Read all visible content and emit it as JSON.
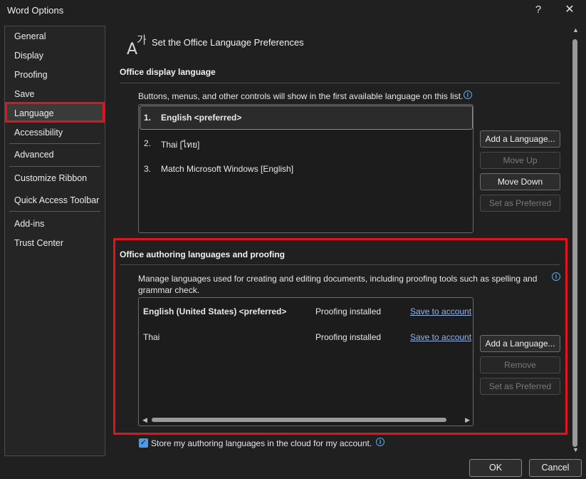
{
  "window": {
    "title": "Word Options",
    "help_label": "?",
    "close_label": "✕"
  },
  "sidebar": {
    "items": [
      {
        "label": "General"
      },
      {
        "label": "Display"
      },
      {
        "label": "Proofing"
      },
      {
        "label": "Save"
      },
      {
        "label": "Language"
      },
      {
        "label": "Accessibility"
      },
      {
        "label": "Advanced"
      },
      {
        "label": "Customize Ribbon"
      },
      {
        "label": "Quick Access Toolbar"
      },
      {
        "label": "Add-ins"
      },
      {
        "label": "Trust Center"
      }
    ],
    "active": "Language"
  },
  "header": {
    "icon": "language-icon",
    "title": "Set the Office Language Preferences"
  },
  "display_language": {
    "title": "Office display language",
    "description": "Buttons, menus, and other controls will show in the first available language on this list.",
    "items": [
      {
        "num": "1.",
        "label": "English <preferred>"
      },
      {
        "num": "2.",
        "label": "Thai [ไทย]"
      },
      {
        "num": "3.",
        "label": "Match Microsoft Windows [English]"
      }
    ],
    "buttons": {
      "add": "Add a Language...",
      "move_up": "Move Up",
      "move_down": "Move Down",
      "set_preferred": "Set as Preferred"
    }
  },
  "authoring": {
    "title": "Office authoring languages and proofing",
    "description": "Manage languages used for creating and editing documents, including proofing tools such as spelling and grammar check.",
    "rows": [
      {
        "language": "English (United States) <preferred>",
        "status": "Proofing installed",
        "action": "Save to account"
      },
      {
        "language": "Thai",
        "status": "Proofing installed",
        "action": "Save to account"
      }
    ],
    "buttons": {
      "add": "Add a Language...",
      "remove": "Remove",
      "set_preferred": "Set as Preferred"
    }
  },
  "cloud_option": {
    "label": "Store my authoring languages in the cloud for my account.",
    "checked": true
  },
  "footer": {
    "ok": "OK",
    "cancel": "Cancel"
  },
  "colors": {
    "highlight": "#e0141a",
    "link": "#8fb4ec",
    "info": "#5aa8f0",
    "checkbox": "#4b9be8"
  }
}
